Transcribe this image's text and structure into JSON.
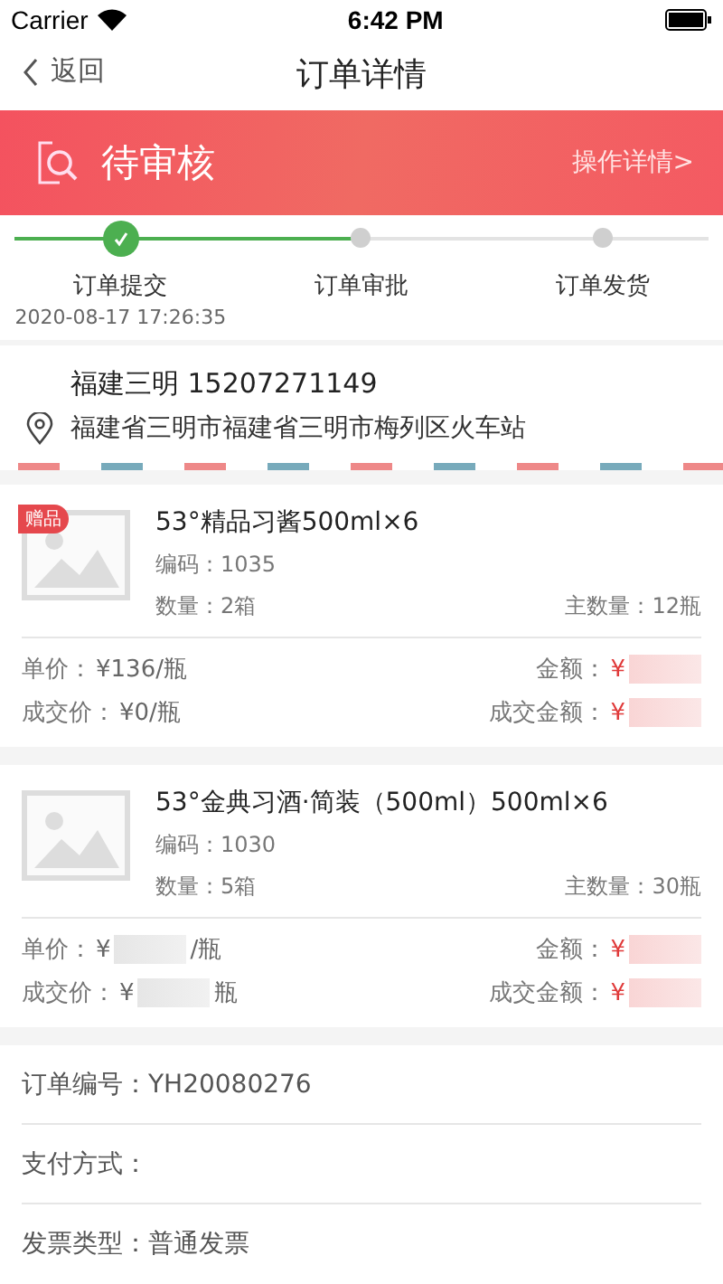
{
  "status_bar": {
    "carrier": "Carrier",
    "time": "6:42 PM"
  },
  "nav": {
    "back": "返回",
    "title": "订单详情"
  },
  "banner": {
    "status": "待审核",
    "link": "操作详情>"
  },
  "steps": [
    {
      "label": "订单提交",
      "time": "2020-08-17  17:26:35",
      "done": true
    },
    {
      "label": "订单审批",
      "done": false
    },
    {
      "label": "订单发货",
      "done": false
    }
  ],
  "address": {
    "contact": "福建三明 15207271149",
    "location": "福建省三明市福建省三明市梅列区火车站"
  },
  "products": [
    {
      "badge": "赠品",
      "name": "53°精品习酱500ml×6",
      "code": "编码：1035",
      "quantity": "数量：2箱",
      "main_quantity": "主数量：12瓶",
      "prices": [
        {
          "label": "单价：",
          "value": "¥136/瓶",
          "redacted": false
        },
        {
          "label": "金额：",
          "value": "¥",
          "redacted": true
        },
        {
          "label": "成交价：",
          "value": "¥0/瓶",
          "redacted": false
        },
        {
          "label": "成交金额：",
          "value": "¥",
          "redacted": true
        }
      ]
    },
    {
      "name": "53°金典习酒·简装（500ml）500ml×6",
      "code": "编码：1030",
      "quantity": "数量：5箱",
      "main_quantity": "主数量：30瓶",
      "prices": [
        {
          "label": "单价：",
          "value": "¥",
          "suffix": "/瓶",
          "redacted": true
        },
        {
          "label": "金额：",
          "value": "¥",
          "redacted": true
        },
        {
          "label": "成交价：",
          "value": "¥",
          "suffix": "瓶",
          "redacted": true
        },
        {
          "label": "成交金额：",
          "value": "¥",
          "redacted": true
        }
      ]
    }
  ],
  "order_info": [
    {
      "label": "订单编号：",
      "value": "YH20080276"
    },
    {
      "label": "支付方式："
    },
    {
      "label": "发票类型：",
      "value": "普通发票"
    }
  ]
}
